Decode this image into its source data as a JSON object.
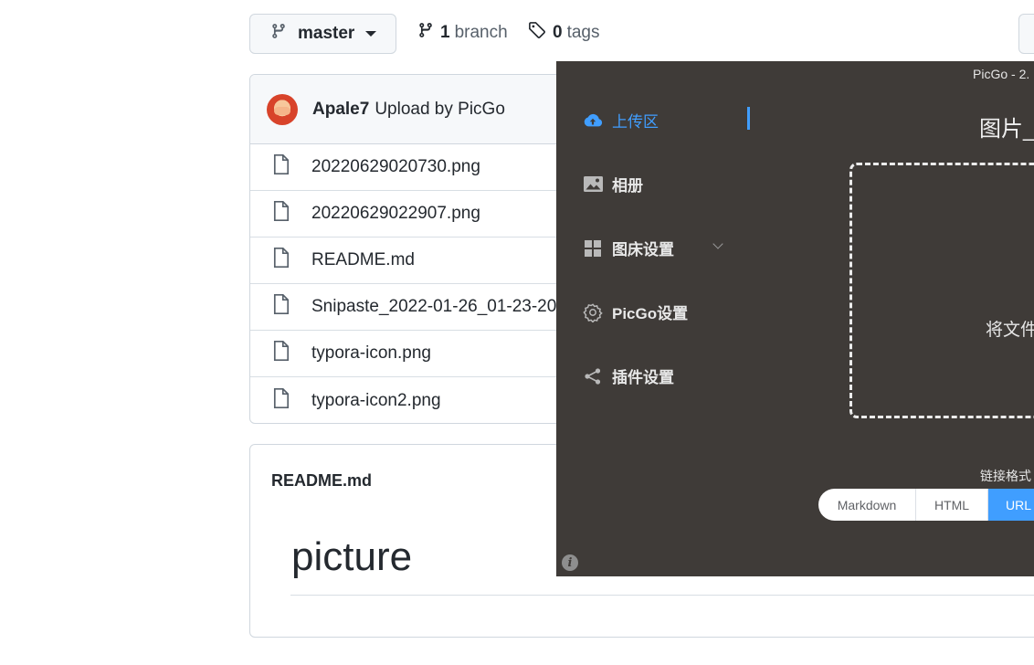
{
  "repo": {
    "branch_selector": {
      "label": "master"
    },
    "branches": {
      "count": "1",
      "label": "branch"
    },
    "tags": {
      "count": "0",
      "label": "tags"
    },
    "commit": {
      "author": "Apale7",
      "message": "Upload by PicGo"
    },
    "files": [
      {
        "name": "20220629020730.png",
        "icon": "file-icon"
      },
      {
        "name": "20220629022907.png",
        "icon": "file-icon"
      },
      {
        "name": "README.md",
        "icon": "file-icon"
      },
      {
        "name": "Snipaste_2022-01-26_01-23-20.",
        "icon": "file-icon"
      },
      {
        "name": "typora-icon.png",
        "icon": "file-icon"
      },
      {
        "name": "typora-icon2.png",
        "icon": "file-icon"
      }
    ],
    "readme": {
      "title": "README.md",
      "heading": "picture"
    }
  },
  "picgo": {
    "window_title": "PicGo - 2.",
    "nav": [
      {
        "label": "上传区",
        "icon": "cloud-upload-icon",
        "active": true
      },
      {
        "label": "相册",
        "icon": "image-icon",
        "active": false
      },
      {
        "label": "图床设置",
        "icon": "grid-icon",
        "active": false
      },
      {
        "label": "PicGo设置",
        "icon": "gear-icon",
        "active": false
      },
      {
        "label": "插件设置",
        "icon": "share-icon",
        "active": false
      }
    ],
    "upload_heading": "图片_",
    "drop_text": "将文件",
    "link_format_label": "链接格式",
    "link_formats": [
      "Markdown",
      "HTML",
      "URL"
    ],
    "selected_format": "URL"
  },
  "colors": {
    "accent": "#409eff",
    "picgo_bg": "#3f3b38",
    "github_border": "#d0d7de"
  }
}
